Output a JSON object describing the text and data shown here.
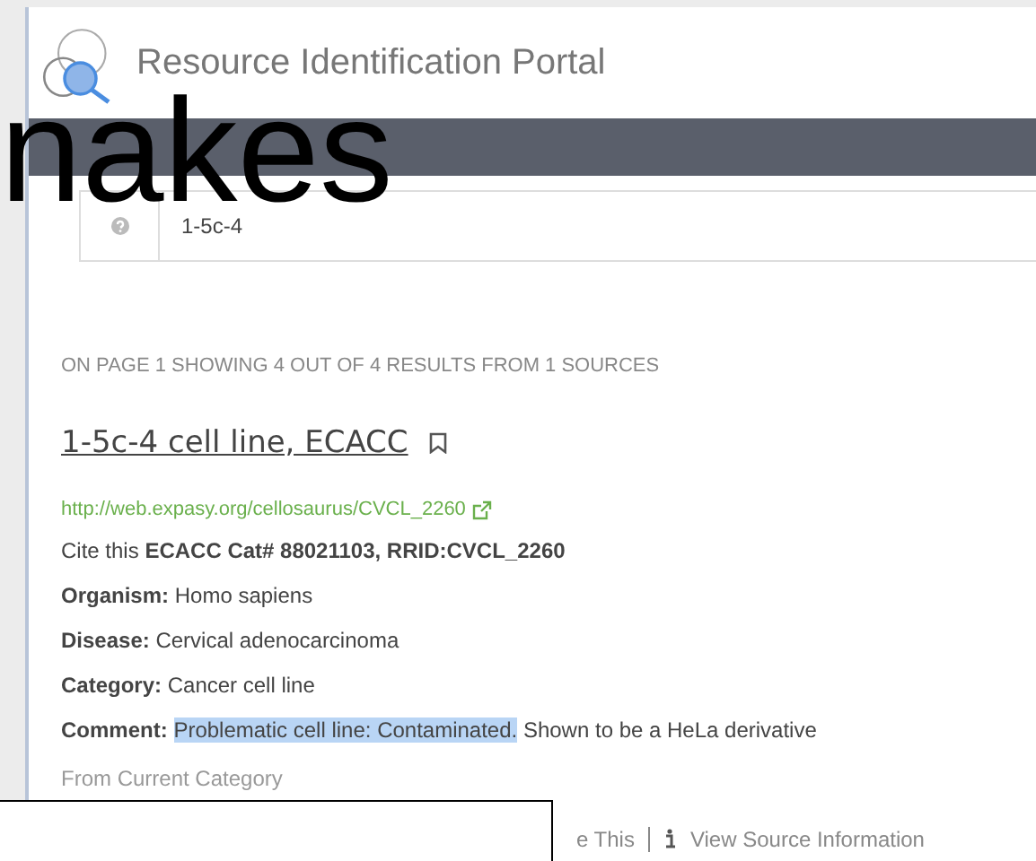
{
  "header": {
    "title": "Resource Identification Portal"
  },
  "search": {
    "value": "1-5c-4"
  },
  "results_summary": "ON PAGE 1 SHOWING 4 OUT OF 4 RESULTS FROM 1 SOURCES",
  "result": {
    "title": "1-5c-4 cell line, ECACC",
    "url": "http://web.expasy.org/cellosaurus/CVCL_2260",
    "cite": "Cite this **ECACC Cat# 88021103, RRID:CVCL_2260**",
    "fields": [
      {
        "label": "Organism:",
        "value": "Homo sapiens"
      },
      {
        "label": "Disease:",
        "value": "Cervical adenocarcinoma"
      },
      {
        "label": "Category:",
        "value": "Cancer cell line"
      }
    ],
    "comment": {
      "label": "Comment:",
      "highlighted": "Problematic cell line: Contaminated.",
      "rest": " Shown to be a HeLa derivative"
    },
    "source_note": "From Current Category",
    "actions": [
      "e This",
      "View Source Information"
    ]
  },
  "overlay": {
    "caption": "nakes"
  }
}
